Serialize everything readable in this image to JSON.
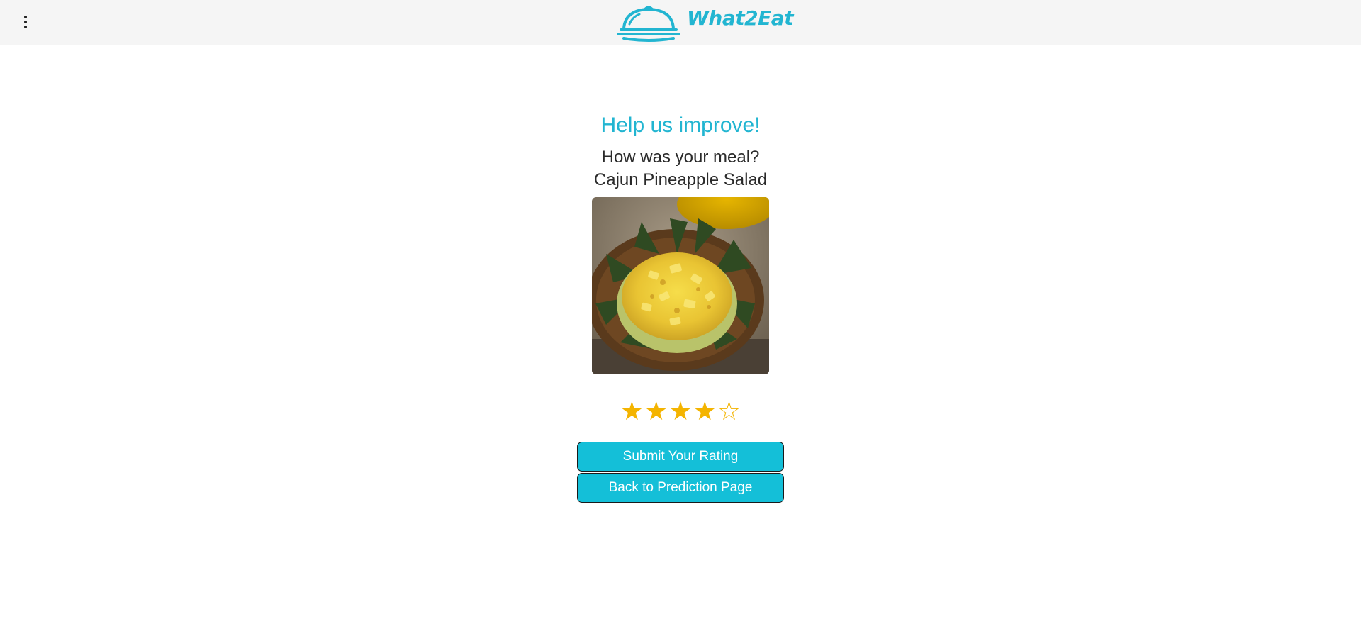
{
  "header": {
    "app_name": "What2Eat",
    "menu_icon": "more-vertical-icon",
    "logo_icon": "cloche-icon",
    "accent_color": "#22b5d1"
  },
  "feedback": {
    "title": "Help us improve!",
    "question": "How was your meal?",
    "dish_name": "Cajun Pineapple Salad",
    "rating": 4,
    "rating_max": 5,
    "star_filled": "★",
    "star_empty": "☆",
    "star_color": "#f4b400"
  },
  "actions": {
    "submit_label": "Submit Your Rating",
    "back_label": "Back to Prediction Page",
    "button_color": "#14bfd8"
  }
}
